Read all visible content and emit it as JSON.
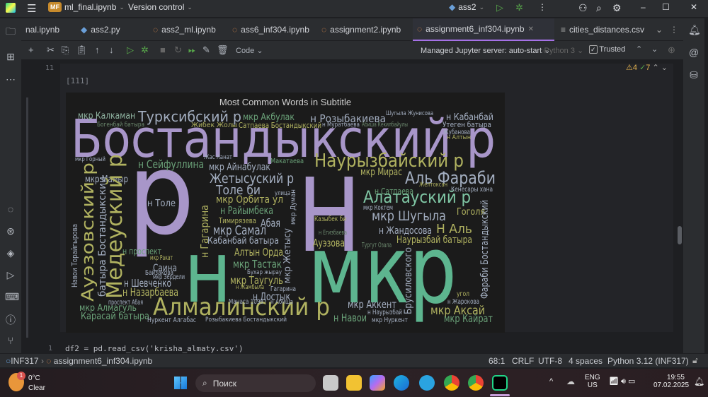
{
  "titlebar": {
    "project_badge": "MF",
    "project_name": "ml_final.ipynb",
    "vcs": "Version control",
    "run_config": "ass2"
  },
  "tabs": [
    {
      "label": "nal.ipynb"
    },
    {
      "label": "ass2.py"
    },
    {
      "label": "ass2_ml.ipynb"
    },
    {
      "label": "ass6_inf304.ipynb"
    },
    {
      "label": "assignment2.ipynb"
    },
    {
      "label": "assignment6_inf304.ipynb",
      "active": true
    },
    {
      "label": "cities_distances.csv"
    }
  ],
  "notebook_toolbar": {
    "cell_type": "Code",
    "server": "Managed Jupyter server: auto-start",
    "kernel": "Python 3",
    "trusted": "Trusted"
  },
  "editor": {
    "line_number_top": "11",
    "warnings": "4",
    "checks": "7",
    "exec_count": "[111]",
    "next_line_number": "1",
    "next_code": "df2 = pd.read_csv('krisha_almaty.csv')"
  },
  "wordcloud": {
    "title": "Most Common Words in Subtitle",
    "colors": {
      "purple": "#a896c9",
      "teal": "#5db58f",
      "olive": "#b0b260",
      "gray": "#a3aec0",
      "green": "#6aa178",
      "dim": "#6d8a6f"
    },
    "words": [
      {
        "text": "Бостандыкский р",
        "color": "#a896c9"
      },
      {
        "text": "р",
        "color": "#a896c9"
      },
      {
        "text": "Н",
        "color": "#a896c9"
      },
      {
        "text": "н",
        "color": "#5db58f"
      },
      {
        "text": "мкр",
        "color": "#5db58f"
      },
      {
        "text": "Алмалинский р",
        "color": "#b0b260"
      },
      {
        "text": "мкр Калкаман",
        "color": "#8fb3a0"
      },
      {
        "text": "Турксибский р",
        "color": "#a3aec0"
      },
      {
        "text": "мкр Акбулак",
        "color": "#6aa178"
      },
      {
        "text": "н Розыбакиева",
        "color": "#a3aec0"
      },
      {
        "text": "Шугыла Жунисова",
        "color": "#a3aec0"
      },
      {
        "text": "н Кабанбай",
        "color": "#a3aec0"
      },
      {
        "text": "Утеген батыра",
        "color": "#a3aec0"
      },
      {
        "text": "Богенбай батыра",
        "color": "#6d8a6f"
      },
      {
        "text": "Жибек Жолы",
        "color": "#b0b260"
      },
      {
        "text": "Сатпаева Бостандыкский",
        "color": "#b0b260"
      },
      {
        "text": "н Муратбаева",
        "color": "#a3aec0"
      },
      {
        "text": "Абиша Кекилбайулы",
        "color": "#6d8a6f"
      },
      {
        "text": "Жубанова",
        "color": "#a3aec0"
      },
      {
        "text": "н Алтын",
        "color": "#b0b260"
      },
      {
        "text": "мкр Горный",
        "color": "#a3aec0"
      },
      {
        "text": "Жас Канат",
        "color": "#a3aec0"
      },
      {
        "text": "н Сейфуллина",
        "color": "#6aa178"
      },
      {
        "text": "Макатаева",
        "color": "#6aa178"
      },
      {
        "text": "мкр Айнабулак",
        "color": "#a3aec0"
      },
      {
        "text": "Наурызбайский р",
        "color": "#b0b260"
      },
      {
        "text": "мкр Мирас",
        "color": "#b0b260"
      },
      {
        "text": "мкр Мамыр",
        "color": "#a3aec0"
      },
      {
        "text": "Жетысуский р",
        "color": "#a3aec0"
      },
      {
        "text": "Аль Фараби",
        "color": "#a3aec0"
      },
      {
        "text": "Толе би",
        "color": "#a3aec0"
      },
      {
        "text": "мкр Орбита ул",
        "color": "#b0b260"
      },
      {
        "text": "Алатауский р",
        "color": "#7fc6a4"
      },
      {
        "text": "Желтоксан",
        "color": "#b0b260"
      },
      {
        "text": "н Сатпаева",
        "color": "#6aa178"
      },
      {
        "text": "Кенесары хана",
        "color": "#a3aec0"
      },
      {
        "text": "н Толе",
        "color": "#a3aec0"
      },
      {
        "text": "н Райымбека",
        "color": "#6aa178"
      },
      {
        "text": "мкр Коктем",
        "color": "#a3aec0"
      },
      {
        "text": "Гоголя",
        "color": "#b0b260"
      },
      {
        "text": "мкр Шугыла",
        "color": "#a3aec0"
      },
      {
        "text": "Абая",
        "color": "#a3aec0"
      },
      {
        "text": "Тимирязева",
        "color": "#b0b260"
      },
      {
        "text": "Казыбек би",
        "color": "#b0b260"
      },
      {
        "text": "мкр Самал",
        "color": "#a3aec0"
      },
      {
        "text": "н Жандосова",
        "color": "#a3aec0"
      },
      {
        "text": "Н Аль",
        "color": "#b0b260"
      },
      {
        "text": "н Егизбаева",
        "color": "#6d8a6f"
      },
      {
        "text": "Кабанбай батыра",
        "color": "#a3aec0"
      },
      {
        "text": "Наурызбай батыра",
        "color": "#b0b260"
      },
      {
        "text": "Ауэзова",
        "color": "#b0b260"
      },
      {
        "text": "Тургут Озала",
        "color": "#6d8a6f"
      },
      {
        "text": "Алтын Орда",
        "color": "#b0b260"
      },
      {
        "text": "н проспект",
        "color": "#6aa178"
      },
      {
        "text": "мкр Ракат",
        "color": "#b0b260"
      },
      {
        "text": "мкр Тастак",
        "color": "#6aa178"
      },
      {
        "text": "Саина",
        "color": "#a3aec0"
      },
      {
        "text": "Байзакова",
        "color": "#a3aec0"
      },
      {
        "text": "Бухар жырау",
        "color": "#a3aec0"
      },
      {
        "text": "мкр Зердели",
        "color": "#a3aec0"
      },
      {
        "text": "мкр Таугуль",
        "color": "#b0b260"
      },
      {
        "text": "н Шевченко",
        "color": "#a3aec0"
      },
      {
        "text": "н Жамбыла",
        "color": "#b0b260"
      },
      {
        "text": "Гагарина",
        "color": "#a3aec0"
      },
      {
        "text": "н Назарбаева",
        "color": "#b0b260"
      },
      {
        "text": "н Достык",
        "color": "#a3aec0"
      },
      {
        "text": "проспект Абая",
        "color": "#a3aec0"
      },
      {
        "text": "Манаса 109а",
        "color": "#a3aec0"
      },
      {
        "text": "н Абиша",
        "color": "#a3aec0"
      },
      {
        "text": "мкр Алмагуль",
        "color": "#6aa178"
      },
      {
        "text": "мкр Аккент",
        "color": "#a3aec0"
      },
      {
        "text": "н Наурызбай",
        "color": "#a3aec0"
      },
      {
        "text": "мкр Аксай",
        "color": "#b0b260"
      },
      {
        "text": "н Жарокова",
        "color": "#a3aec0"
      },
      {
        "text": "угол",
        "color": "#b0b260"
      },
      {
        "text": "Карасай батыра",
        "color": "#6aa178"
      },
      {
        "text": "Нуркент Алгабас",
        "color": "#a3aec0"
      },
      {
        "text": "Розыбакиева Бостандыкский",
        "color": "#a3aec0"
      },
      {
        "text": "н Навои",
        "color": "#6aa178"
      },
      {
        "text": "мкр Нуркент",
        "color": "#a3aec0"
      },
      {
        "text": "мкр Кайрат",
        "color": "#6aa178"
      },
      {
        "text": "Медеуский р",
        "color": "#b0b260"
      },
      {
        "text": "Ауэзовский р",
        "color": "#b0b260"
      },
      {
        "text": "батыра Бостандыкский",
        "color": "#a3aec0"
      },
      {
        "text": "Фараби Бостандыкский",
        "color": "#a3aec0"
      },
      {
        "text": "Брусиловского",
        "color": "#a3aec0"
      },
      {
        "text": "н Гагарина",
        "color": "#b0b260"
      },
      {
        "text": "мкр Жетысу",
        "color": "#a3aec0"
      },
      {
        "text": "Навои Торайгырова",
        "color": "#a3aec0"
      },
      {
        "text": "мкр Думан",
        "color": "#a3aec0"
      },
      {
        "text": "улица",
        "color": "#a3aec0"
      }
    ]
  },
  "statusbar": {
    "project": "INF317",
    "file": "assignment6_inf304.ipynb",
    "position": "68:1",
    "line_sep": "CRLF",
    "encoding": "UTF-8",
    "indent": "4 spaces",
    "interpreter": "Python 3.12 (INF317)"
  },
  "taskbar": {
    "temp": "0°C",
    "weather": "Clear",
    "weather_badge": "1",
    "search_placeholder": "Поиск",
    "lang1": "ENG",
    "lang2": "US",
    "time": "19:55",
    "date": "07.02.2025"
  }
}
